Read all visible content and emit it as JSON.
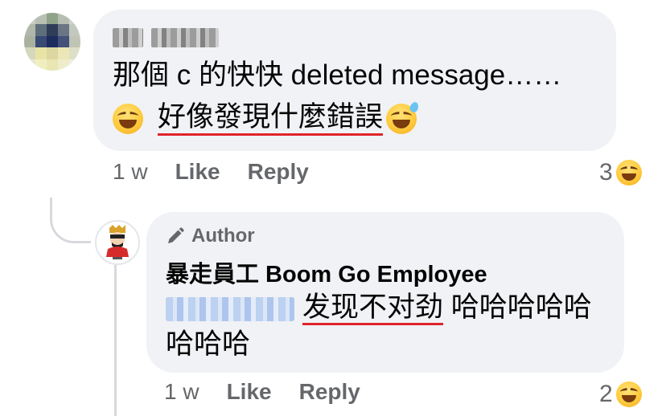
{
  "comment1": {
    "line1": "那個 c 的快快 deleted message……",
    "line2_underlined": "好像發現什麼錯誤",
    "time": "1 w",
    "like_label": "Like",
    "reply_label": "Reply",
    "reaction_count": "3",
    "reaction_icon": "laughing-emoji-icon"
  },
  "reply": {
    "author_badge": "Author",
    "name": "暴走員工 Boom Go Employee",
    "underlined_text": "发现不对劲",
    "trailing_text": " 哈哈哈哈哈哈哈哈",
    "time": "1 w",
    "like_label": "Like",
    "reply_label": "Reply",
    "reaction_count": "2",
    "reaction_icon": "laughing-emoji-icon"
  },
  "colors": {
    "bubble": "#f0f2f5",
    "meta_text": "#65676b",
    "underline": "#e0242b",
    "connector": "#d7d9dd"
  }
}
